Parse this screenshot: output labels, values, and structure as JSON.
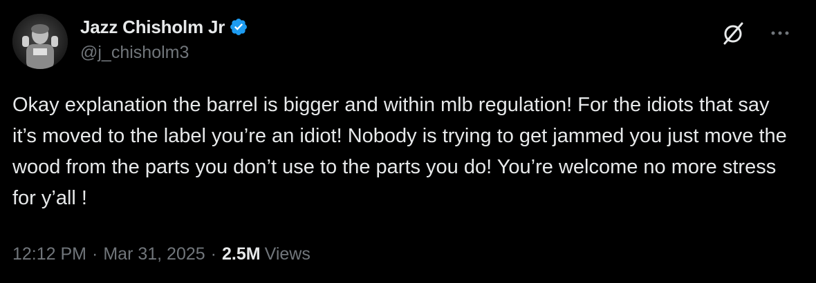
{
  "author": {
    "display_name": "Jazz Chisholm Jr",
    "handle": "@j_chisholm3",
    "verified": true
  },
  "tweet": {
    "text": "Okay explanation the barrel is bigger and within mlb regulation! For the idiots that say it’s moved to the label you’re an idiot! Nobody is trying to get jammed you just move the wood from the parts you don’t use to the parts you do! You’re welcome no more stress for y’all !",
    "time": "12:12 PM",
    "date": "Mar 31, 2025",
    "separator": "·",
    "views_count": "2.5M",
    "views_label": "Views"
  },
  "icons": {
    "verified": "verified-badge-icon",
    "grok": "grok-icon",
    "more": "more-icon"
  },
  "colors": {
    "background": "#000000",
    "text": "#e7e9ea",
    "secondary": "#71767b",
    "verified_blue": "#1d9bf0"
  }
}
